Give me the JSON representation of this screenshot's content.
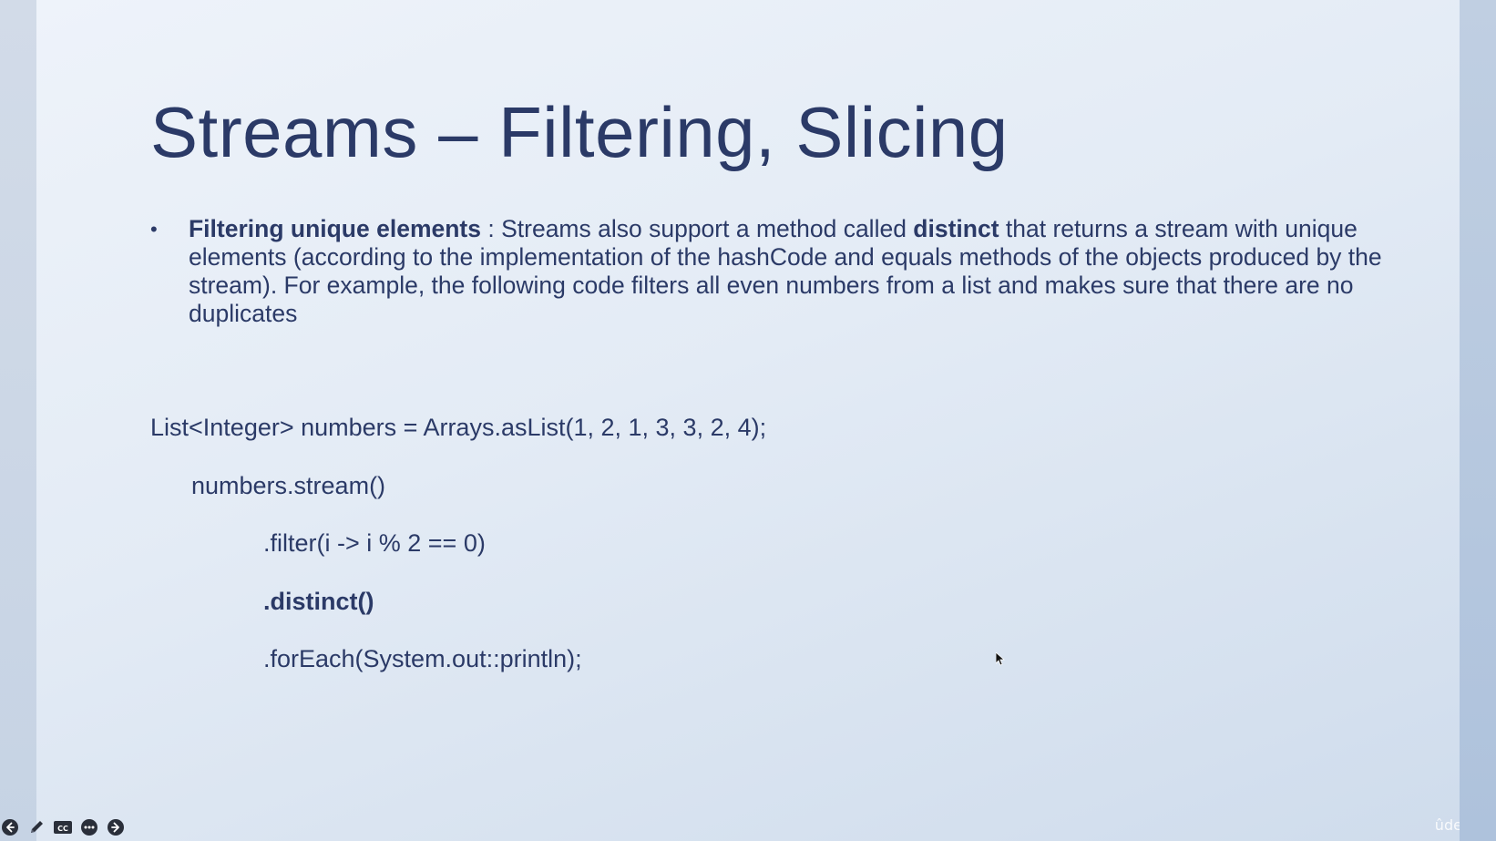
{
  "slide": {
    "title": "Streams – Filtering, Slicing",
    "bullet": {
      "marker": "•",
      "heading": "Filtering unique elements",
      "text_before": " : Streams also support a method called ",
      "keyword": "distinct",
      "text_after": " that returns a stream with unique elements (according to the implementation of the hashCode and equals methods of the objects produced by the stream). For example, the following code filters all even numbers from a list and makes sure that there are no duplicates"
    },
    "code": {
      "line1": "List<Integer> numbers = Arrays.asList(1, 2, 1, 3, 3, 2, 4);",
      "line2": "numbers.stream()",
      "line3": ".filter(i -> i % 2 == 0)",
      "line4": ".distinct()",
      "line5": ".forEach(System.out::println);"
    }
  },
  "player": {
    "controls": [
      "previous-icon",
      "pen-icon",
      "captions-icon",
      "more-icon",
      "next-icon"
    ],
    "captions_label": "CC",
    "brand": "ûdemy"
  },
  "colors": {
    "title": "#2b3a67",
    "background": "#e3ebf5",
    "accent": "#f07a2a"
  }
}
